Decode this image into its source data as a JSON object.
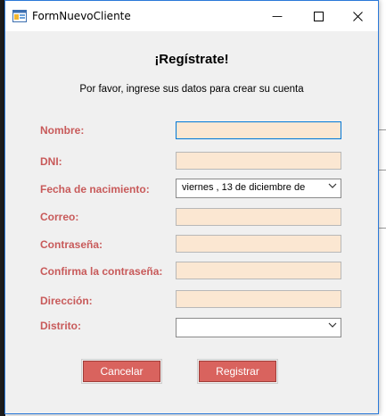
{
  "window": {
    "title": "FormNuevoCliente",
    "minimize_glyph": "—",
    "maximize_glyph": "☐",
    "close_glyph": "✕"
  },
  "form": {
    "heading": "¡Regístrate!",
    "subheading": "Por favor, ingrese sus datos para crear su cuenta",
    "labels": {
      "nombre": "Nombre:",
      "dni": "DNI:",
      "fecha": "Fecha de nacimiento:",
      "correo": "Correo:",
      "contrasena": "Contraseña:",
      "confirma": "Confirma la contraseña:",
      "direccion": "Dirección:",
      "distrito": "Distrito:"
    },
    "values": {
      "nombre": "",
      "dni": "",
      "fecha": "viernes  , 13 de  diciembre  de",
      "correo": "",
      "contrasena": "",
      "confirma": "",
      "direccion": "",
      "distrito": ""
    },
    "buttons": {
      "cancel": "Cancelar",
      "register": "Registrar"
    }
  },
  "colors": {
    "label": "#c85a5a",
    "field_bg": "#fbe7d2",
    "button_bg": "#d9635e",
    "accent": "#2b79d8"
  }
}
